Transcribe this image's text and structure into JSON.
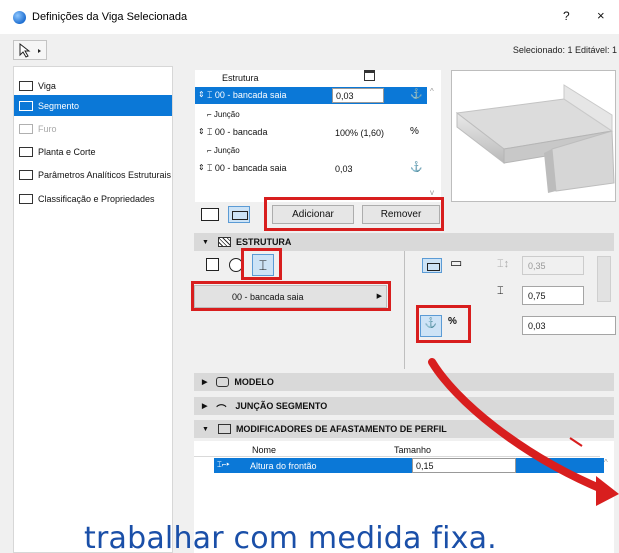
{
  "window": {
    "title": "Definições da Viga Selecionada",
    "help_label": "?",
    "close_label": "×"
  },
  "status": "Selecionado: 1 Editável: 1",
  "sidebar": {
    "items": [
      {
        "label": "Viga",
        "state": "normal"
      },
      {
        "label": "Segmento",
        "state": "active"
      },
      {
        "label": "Furo",
        "state": "disabled"
      },
      {
        "label": "Planta e Corte",
        "state": "normal"
      },
      {
        "label": "Parâmetros Analíticos Estruturais",
        "state": "normal"
      },
      {
        "label": "Classificação e Propriedades",
        "state": "normal"
      }
    ]
  },
  "structure_list": {
    "header": "Estrutura",
    "rows": [
      {
        "type": "profile",
        "name": "00 - bancada saia",
        "value": "0,03",
        "selected": true
      },
      {
        "type": "junction",
        "name": "Junção"
      },
      {
        "type": "profile",
        "name": "00 - bancada",
        "value": "100% (1,60)",
        "selected": false
      },
      {
        "type": "junction",
        "name": "Junção"
      },
      {
        "type": "profile",
        "name": "00 - bancada saia",
        "value": "0,03",
        "selected": false
      }
    ]
  },
  "buttons": {
    "add": "Adicionar",
    "remove": "Remover"
  },
  "sections": {
    "structure": "ESTRUTURA",
    "model": "MODELO",
    "segment_junction": "JUNÇÃO SEGMENTO",
    "profile_offset_modifiers": "MODIFICADORES DE AFASTAMENTO DE PERFIL"
  },
  "structure_panel": {
    "profile_selected": "00 - bancada saia",
    "width_value": "0,35",
    "height_value": "0,75",
    "offset_value": "0,03",
    "anchor_percent_label": "%"
  },
  "modifiers_table": {
    "columns": [
      "Nome",
      "Tamanho"
    ],
    "rows": [
      {
        "name": "Altura do frontão",
        "value": "0,15"
      }
    ]
  },
  "caption": "trabalhar com medida fixa.",
  "colors": {
    "accent": "#0b78d7",
    "annotation_red": "#d81e1e",
    "caption_blue": "#1a4fa8"
  }
}
